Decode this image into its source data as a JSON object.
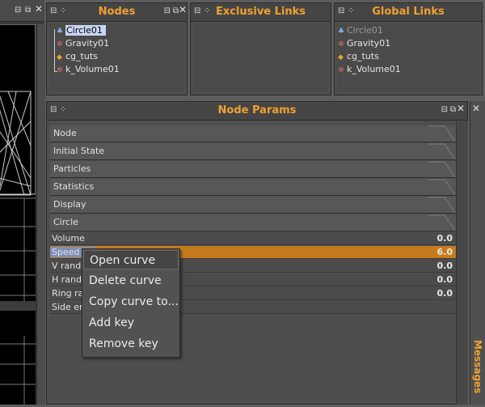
{
  "viewport": {
    "window_icons": [
      "⊟",
      "✕"
    ]
  },
  "nodes_panel": {
    "title": "Nodes",
    "items": [
      {
        "label": "Circle01",
        "icon": "circle-emitter-icon",
        "glyph": "♣",
        "color": "#8fb0e8"
      },
      {
        "label": "Gravity01",
        "icon": "gravity-icon",
        "glyph": "✲",
        "color": "#e07070"
      },
      {
        "label": "cg_tuts",
        "icon": "particle-group-icon",
        "glyph": "◆",
        "color": "#f0a030"
      },
      {
        "label": "k_Volume01",
        "icon": "volume-icon",
        "glyph": "✲",
        "color": "#e07070"
      }
    ]
  },
  "exclusive_panel": {
    "title": "Exclusive Links"
  },
  "global_panel": {
    "title": "Global Links",
    "items": [
      {
        "label": "Circle01",
        "icon": "circle-emitter-icon",
        "glyph": "♣",
        "color": "#8fb0e8"
      },
      {
        "label": "Gravity01",
        "icon": "gravity-icon",
        "glyph": "✲",
        "color": "#e07070"
      },
      {
        "label": "cg_tuts",
        "icon": "particle-group-icon",
        "glyph": "◆",
        "color": "#f0a030"
      },
      {
        "label": "k_Volume01",
        "icon": "volume-icon",
        "glyph": "✲",
        "color": "#e07070"
      }
    ]
  },
  "node_params": {
    "title": "Node Params",
    "sections": [
      "Node",
      "Initial State",
      "Particles",
      "Statistics",
      "Display",
      "Circle"
    ],
    "params": [
      {
        "label": "Volume",
        "value": "0.0"
      },
      {
        "label": "Speed",
        "value": "6.0"
      },
      {
        "label": "V rando",
        "value": "0.0"
      },
      {
        "label": "H rando",
        "value": "0.0"
      },
      {
        "label": "Ring rat",
        "value": "0.0"
      },
      {
        "label": "Side em",
        "value": ""
      }
    ]
  },
  "context_menu": {
    "items": [
      "Open curve",
      "Delete curve",
      "Copy curve to...",
      "Add key",
      "Remove key"
    ]
  },
  "messages": {
    "label": "Messages"
  },
  "colors": {
    "accent": "#f0a030",
    "highlight_row": "#c47b1e",
    "selection": "#c8d6f4"
  }
}
